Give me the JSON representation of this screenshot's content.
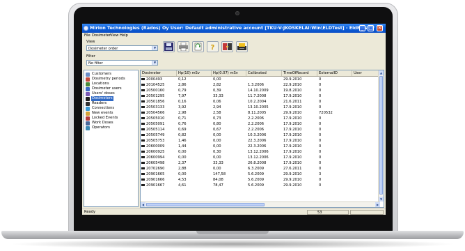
{
  "window": {
    "title": "Mirion Technologies (Rados) Oy User: Default administrative account [TKU-V-JKOSKELAI:Win\\ELDTest] - EldMaster",
    "minimize_glyph": "_",
    "maximize_glyph": "□",
    "close_glyph": "×"
  },
  "menu": [
    "File",
    "Dosimeter",
    "View",
    "Help"
  ],
  "view": {
    "label": "View",
    "selected": "Dosimeter order"
  },
  "filter": {
    "label": "Filter",
    "selected": "No filter"
  },
  "toolbar_icons": [
    "save-icon",
    "print-icon",
    "refresh-icon",
    "help-icon",
    "connect-icon",
    "reader-icon"
  ],
  "sidebar": {
    "items": [
      {
        "label": "Customers",
        "icon": "customers-icon",
        "color": "#6a8fc8"
      },
      {
        "label": "Dosimetry periods",
        "icon": "periods-icon",
        "color": "#c44a3a"
      },
      {
        "label": "Locations",
        "icon": "locations-icon",
        "color": "#4a8a3a"
      },
      {
        "label": "Dosimeter users",
        "icon": "users-icon",
        "color": "#3a6ac4"
      },
      {
        "label": "Users' doses",
        "icon": "doses-icon",
        "color": "#7a5ab4"
      },
      {
        "label": "Dosimeters",
        "icon": "dosimeters-icon",
        "color": "#1f1f1f",
        "selected": true
      },
      {
        "label": "Readers",
        "icon": "readers-icon",
        "color": "#2f2f2f"
      },
      {
        "label": "Connections",
        "icon": "connections-icon",
        "color": "#3a9ad4"
      },
      {
        "label": "New events",
        "icon": "new-events-icon",
        "color": "#d4a33a"
      },
      {
        "label": "Locked Events",
        "icon": "locked-events-icon",
        "color": "#b43a3a"
      },
      {
        "label": "Work Doses",
        "icon": "work-doses-icon",
        "color": "#4a6a9a"
      },
      {
        "label": "Operators",
        "icon": "operators-icon",
        "color": "#3a8ab4"
      }
    ]
  },
  "table": {
    "columns": [
      "Dosimeter",
      "Hp(10) mSv",
      "Hp(0.07) mSv",
      "Calibrated",
      "TimeOfRecord",
      "ExternalID",
      "User"
    ],
    "rows": [
      [
        "2000493",
        "0,12",
        "0,00",
        "",
        "29.9.2010",
        "0",
        ""
      ],
      [
        "20104525",
        "2,86",
        "2,82",
        "1.3.2006",
        "22.9.2010",
        "0",
        ""
      ],
      [
        "20500160",
        "0,79",
        "0,39",
        "14.10.2009",
        "19.8.2010",
        "0",
        ""
      ],
      [
        "20501295",
        "7,97",
        "33,33",
        "11.7.2008",
        "17.9.2010",
        "0",
        ""
      ],
      [
        "20501856",
        "0,16",
        "0,06",
        "10.2.2004",
        "21.6.2011",
        "0",
        ""
      ],
      [
        "20503133",
        "3,92",
        "2,94",
        "13.10.2005",
        "17.9.2010",
        "0",
        ""
      ],
      [
        "20504566",
        "2,98",
        "2,58",
        "8.11.2005",
        "29.9.2010",
        "720532",
        ""
      ],
      [
        "20505010",
        "0,71",
        "0,73",
        "2.2.2006",
        "17.9.2010",
        "0",
        ""
      ],
      [
        "20505091",
        "0,76",
        "0,80",
        "2.2.2006",
        "17.9.2010",
        "0",
        ""
      ],
      [
        "20505114",
        "0,69",
        "0,67",
        "2.2.2006",
        "17.9.2010",
        "0",
        ""
      ],
      [
        "20505749",
        "0,82",
        "0,00",
        "10.3.2006",
        "17.9.2010",
        "0",
        ""
      ],
      [
        "20505753",
        "1,46",
        "0,00",
        "22.3.2006",
        "17.9.2010",
        "0",
        ""
      ],
      [
        "20600009",
        "1,44",
        "0,00",
        "22.3.2006",
        "17.9.2010",
        "0",
        ""
      ],
      [
        "20600925",
        "0,00",
        "0,30",
        "13.12.2006",
        "17.9.2010",
        "0",
        ""
      ],
      [
        "20600994",
        "0,00",
        "0,00",
        "13.12.2006",
        "17.9.2010",
        "0",
        ""
      ],
      [
        "20605498",
        "2,37",
        "33,33",
        "26.8.2008",
        "17.9.2010",
        "0",
        ""
      ],
      [
        "20702690",
        "2,88",
        "0,00",
        "6.3.2009",
        "27.6.2011",
        "0",
        ""
      ],
      [
        "20901665",
        "0,00",
        "147,58",
        "5.6.2009",
        "29.9.2010",
        "3",
        ""
      ],
      [
        "20901666",
        "4,53",
        "84,08",
        "5.6.2009",
        "29.9.2010",
        "0",
        ""
      ],
      [
        "20901667",
        "4,61",
        "78,47",
        "5.6.2009",
        "29.9.2010",
        "0",
        ""
      ]
    ]
  },
  "scroll_glyphs": {
    "up": "▲",
    "down": "▼",
    "left": "◀",
    "right": "▶"
  },
  "status": {
    "text": "Ready",
    "count": "53"
  }
}
